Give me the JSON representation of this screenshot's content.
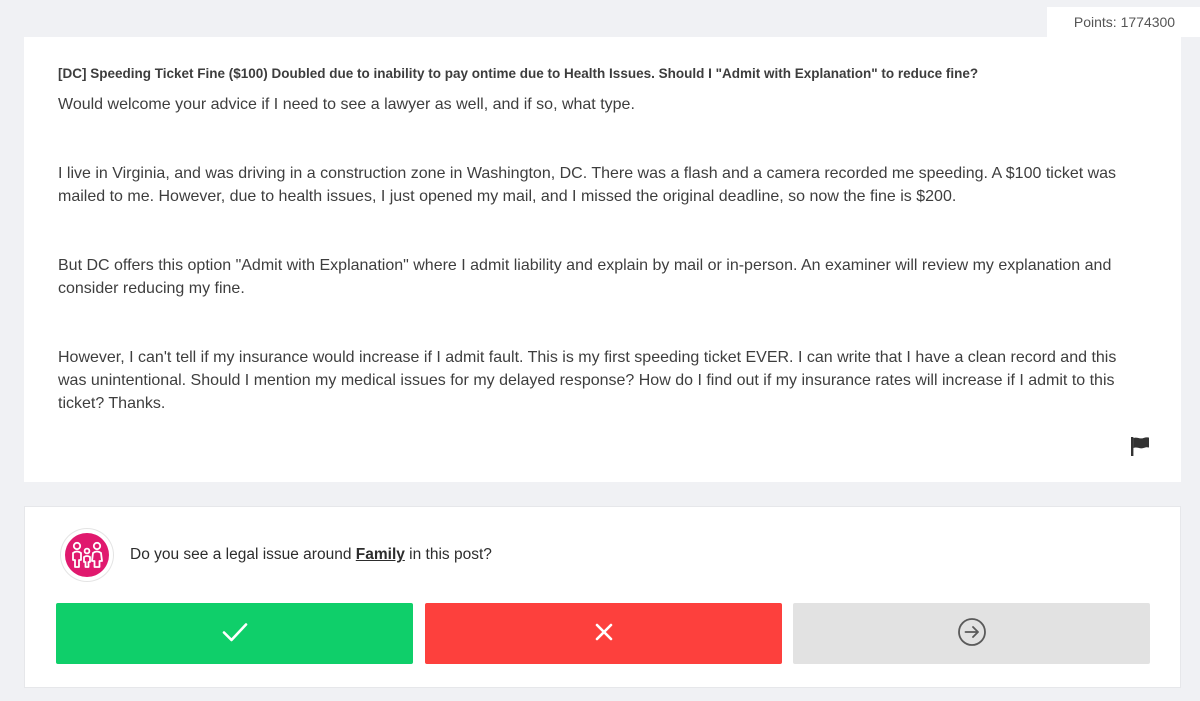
{
  "points": {
    "text": "Points: 1774300"
  },
  "post": {
    "title": "[DC] Speeding Ticket Fine ($100) Doubled due to inability to pay ontime due to Health Issues. Should I \"Admit with Explanation\" to reduce fine?",
    "paragraphs": [
      "Would welcome your advice if I need to see a lawyer as well, and if so, what type.",
      "I live in Virginia, and was driving in a construction zone in Washington, DC.  There was a flash and a camera recorded me speeding.  A $100 ticket was mailed to me.  However, due to health issues, I just opened my mail, and I missed the original deadline, so now the fine is $200.",
      "But DC offers this option \"Admit with Explanation\" where I admit liability and explain by mail or in-person. An examiner will review my explanation and consider reducing my fine.",
      "However, I can't tell if my insurance would increase if I admit fault.  This is my first speeding ticket EVER. I can write that I have a clean record and this was unintentional.  Should I mention my medical issues for my delayed response?  How do I find out if my insurance rates will increase if I admit to this ticket? Thanks."
    ],
    "flag_icon": "flag-icon"
  },
  "question": {
    "prefix": "Do you see a legal issue around ",
    "topic": "Family",
    "suffix": " in this post?",
    "icon": "family-icon",
    "icon_color": "#e0196e"
  },
  "buttons": {
    "yes": {
      "icon": "checkmark-icon",
      "color": "#0fcf6a"
    },
    "no": {
      "icon": "close-icon",
      "color": "#fd403d"
    },
    "skip": {
      "icon": "arrow-right-circle-icon",
      "color": "#e2e2e2"
    }
  }
}
